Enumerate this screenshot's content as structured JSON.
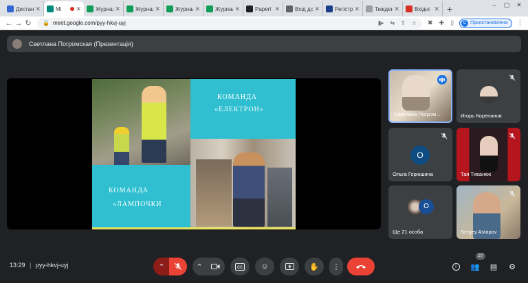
{
  "browser": {
    "tabs": [
      {
        "label": "Дистан",
        "color": "#3367d6",
        "active": false
      },
      {
        "label": "Mi",
        "color": "#00897b",
        "active": true
      },
      {
        "label": "Журнал",
        "color": "#0f9d58",
        "active": false
      },
      {
        "label": "Журнал",
        "color": "#0f9d58",
        "active": false
      },
      {
        "label": "Журнал",
        "color": "#0f9d58",
        "active": false
      },
      {
        "label": "Журнал",
        "color": "#0f9d58",
        "active": false
      },
      {
        "label": "Paperl",
        "color": "#202124",
        "active": false
      },
      {
        "label": "Вхід до",
        "color": "#5f6368",
        "active": false
      },
      {
        "label": "Регістр",
        "color": "#1a3e8c",
        "active": false
      },
      {
        "label": "Тиждень",
        "color": "#9aa0a6",
        "active": false
      },
      {
        "label": "Вхідні",
        "color": "#d93025",
        "active": false
      }
    ],
    "url": "meet.google.com/pyy-hkvj-uyj",
    "profile_label": "Приостановлена",
    "profile_initial": "C"
  },
  "presentation_bar": {
    "title": "Светлана Погромская (Презентація)"
  },
  "slide": {
    "text_e1": "КОМАНДА",
    "text_e2": "«ЕЛЕКТРОН»",
    "text_l1": "КОМАНДА",
    "text_l2": "«ЛАМПОЧКИ"
  },
  "participants": [
    {
      "name": "Светлана Погром...",
      "speaking": true
    },
    {
      "name": "Игорь Корепанов",
      "muted": true
    },
    {
      "name": "Ольга Горюшина",
      "initial": "О",
      "muted": true
    },
    {
      "name": "Тая Тиванюк",
      "muted": true
    },
    {
      "name": "Ще 21 особа",
      "initial": "O"
    },
    {
      "name": "Sergey Astapov",
      "muted": true
    }
  ],
  "meeting": {
    "time": "13:29",
    "code": "pyy-hkvj-uyj",
    "participant_count": "27"
  }
}
